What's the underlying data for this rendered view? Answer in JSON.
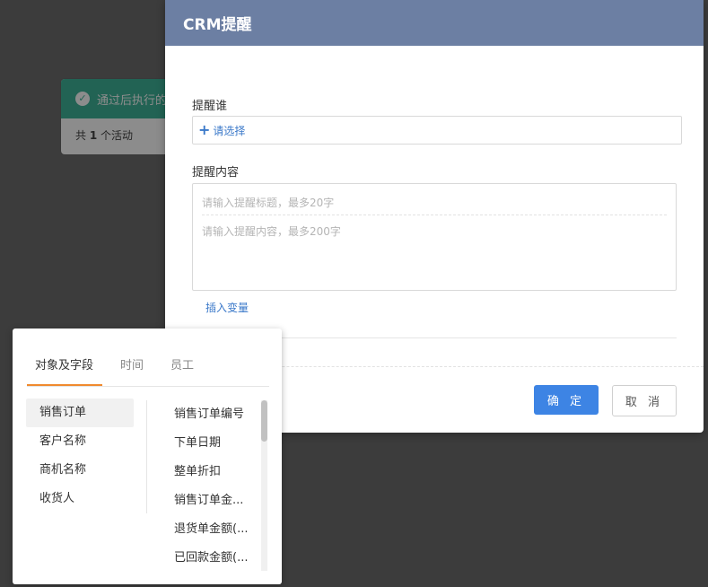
{
  "background": {
    "card_title": "通过后执行的",
    "card_count_prefix": "共",
    "card_count": "1",
    "card_count_suffix": "个活动",
    "check_icon": "check-circle-icon"
  },
  "modal": {
    "title": "CRM提醒",
    "who_label": "提醒谁",
    "who_button": "请选择",
    "content_label": "提醒内容",
    "title_placeholder": "请输入提醒标题，最多20字",
    "body_placeholder": "请输入提醒内容，最多200字",
    "insert_variable": "插入变量",
    "ok_button": "确 定",
    "cancel_button": "取 消"
  },
  "variable_popover": {
    "tabs": [
      "对象及字段",
      "时间",
      "员工"
    ],
    "active_tab": 0,
    "objects": [
      "销售订单",
      "客户名称",
      "商机名称",
      "收货人"
    ],
    "active_object": 0,
    "fields": [
      "销售订单编号",
      "下单日期",
      "整单折扣",
      "销售订单金...",
      "退货单金额(...",
      "已回款金额(..."
    ]
  },
  "colors": {
    "header": "#6c7fa3",
    "primary": "#3d84e4",
    "link": "#3a78c9",
    "tab_accent": "#f08a2e",
    "card_green": "#3fb59a"
  }
}
